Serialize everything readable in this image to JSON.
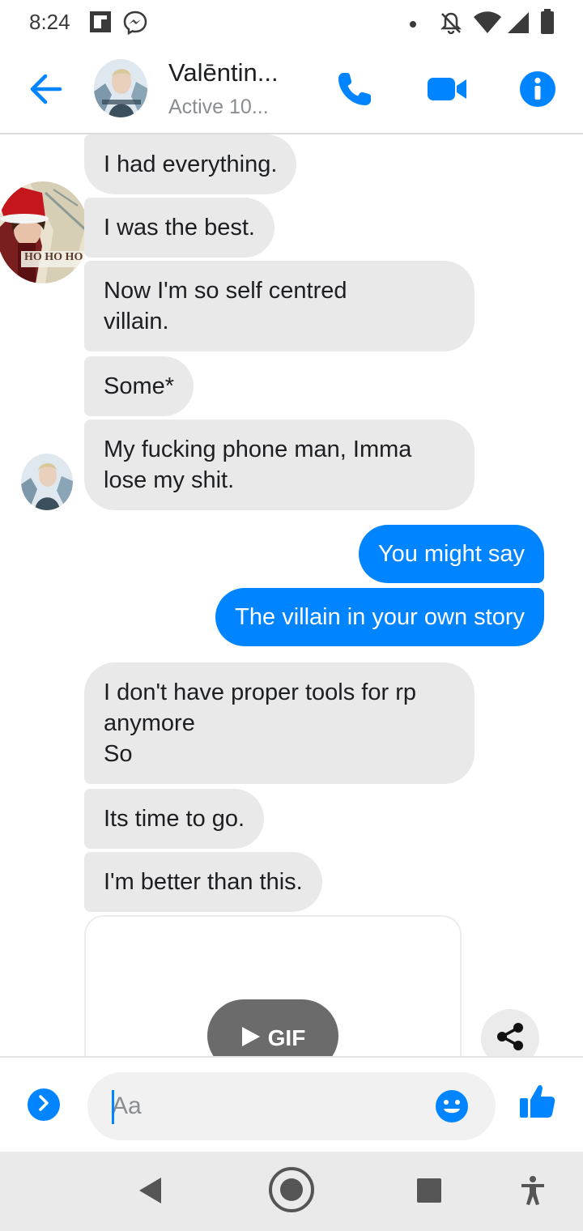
{
  "status_bar": {
    "time": "8:24",
    "left_icons": [
      "flipboard-icon",
      "messenger-icon"
    ],
    "right_icons": [
      "dot-icon",
      "notifications-off-icon",
      "wifi-icon",
      "signal-icon",
      "battery-icon"
    ]
  },
  "header": {
    "contact_name": "Valēntin...",
    "contact_status": "Active 10...",
    "icons": [
      "back-arrow-icon",
      "phone-icon",
      "video-icon",
      "info-icon"
    ]
  },
  "messages": [
    {
      "direction": "in",
      "text": "I had everything."
    },
    {
      "direction": "in",
      "text": "I was the best."
    },
    {
      "direction": "in",
      "text": "Now I'm so self centred\nvillain."
    },
    {
      "direction": "in",
      "text": "Some*"
    },
    {
      "direction": "in",
      "text": "My fucking phone man, Imma\nlose my shit."
    },
    {
      "direction": "out",
      "text": "You might say"
    },
    {
      "direction": "out",
      "text": "The villain in your own story"
    },
    {
      "direction": "in",
      "text": "I don't have proper tools for rp\nanymore\nSo"
    },
    {
      "direction": "in",
      "text": "Its time to go."
    },
    {
      "direction": "in",
      "text": "I'm better than this."
    }
  ],
  "avatar_overlay_text": "HO HO HO",
  "gif": {
    "label": "GIF"
  },
  "composer": {
    "placeholder": "Aa"
  },
  "colors": {
    "accent": "#0084ff",
    "incoming_bubble": "#e9e9e9",
    "outgoing_text": "#ffffff"
  }
}
